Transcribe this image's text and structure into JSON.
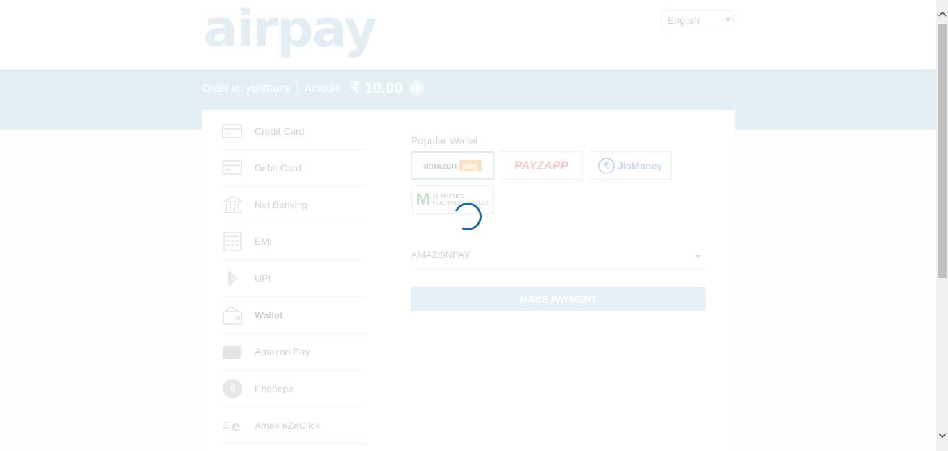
{
  "header": {
    "logo_text": "airpay",
    "language": {
      "selected": "English"
    }
  },
  "order": {
    "order_id_label": "Order Id: yBotboYe",
    "amount_label": "Amount :",
    "amount_value": "₹ 10.00"
  },
  "sidebar": {
    "items": [
      {
        "label": "Credit Card",
        "icon": "credit-card-icon"
      },
      {
        "label": "Debit Card",
        "icon": "debit-card-icon"
      },
      {
        "label": "Net Banking",
        "icon": "bank-icon"
      },
      {
        "label": "EMI",
        "icon": "calculator-icon"
      },
      {
        "label": "UPI",
        "icon": "upi-icon"
      },
      {
        "label": "Wallet",
        "icon": "wallet-icon",
        "active": true
      },
      {
        "label": "Amazon Pay",
        "icon": "amazon-pay-card-icon"
      },
      {
        "label": "Phonepe",
        "icon": "phonepe-icon"
      },
      {
        "label": "Amex eZeClick",
        "icon": "amex-ezeclick-icon"
      }
    ]
  },
  "wallet": {
    "popular_label": "Popular Wallet",
    "tiles": [
      {
        "name": "amazon",
        "text": "amazon",
        "badge": "pay",
        "selected": true
      },
      {
        "name": "payzapp",
        "text": "PAYZAPP"
      },
      {
        "name": "jiomoney",
        "text": "JioMoney",
        "coin": "₹"
      },
      {
        "name": "olamoney",
        "mark": "M",
        "text": "OLAMONEY",
        "subtext": "POSTPAID + WALLET"
      }
    ],
    "selected_wallet": "AMAZONPAY",
    "pay_button": "MAKE PAYMENT"
  },
  "colors": {
    "spinner": "#1e6aa8",
    "band": "#e3eef5",
    "logo": "#e3edf4"
  }
}
